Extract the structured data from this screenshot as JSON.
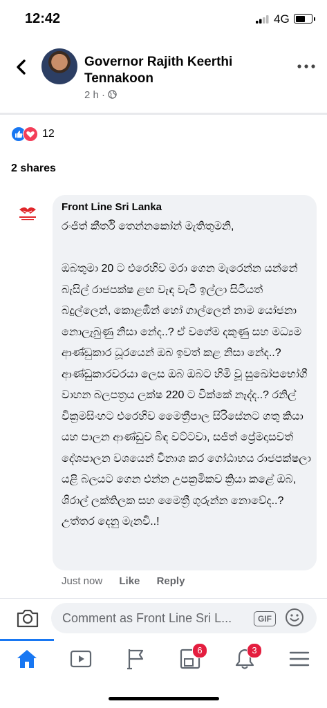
{
  "status_bar": {
    "time": "12:42",
    "network": "4G"
  },
  "post": {
    "author": "Governor Rajith Keerthi Tennakoon",
    "meta": "2 h ·",
    "reaction_count": "12",
    "shares": "2 shares"
  },
  "comment": {
    "author": "Front Line Sri Lanka",
    "text": "රංජිත් කීර්ති තෙන්නකෝන් මැතිතුමනි,\n\nඔබතුමා 20 ට එරෙහිව මරා ගෙන මැරෙන්න යන්නේ බැසිල් රාජපක්ෂ ළඟ වැඳ වැටී ඉල්ලා සිටියත් බදුල්ලෙන්, කොළඹින් හෝ ගාල්ලෙන් නාම යෝජනා නොලැබුණු නිසා නේද..? ඒ වගේම දකුණු සහ මධ්‍යම ආණ්ඩුකාර ධූරයෙන් ඔබ ඉවත් කළ නිසා නේද..? ආණ්ඩුකාරවරයා ලෙස ඔබ ඔබට හිමි වූ සුඛෝපභෝගී වාහන බලපත්‍රය ලක්ෂ 220 ට වික්කේ නැද්ද..? රනිල් වික්‍රමසිංහට එරෙහිව මෛත්‍රීපාල සිරිසේනට ගතු කියා යහ පාලන ආණ්ඩුව බිඳ වට්ටවා, සජිත් ප්‍රේමදාසවත් දේශපාලන වශයෙන් විනාශ කර ගෝඨාභය රාජපක්ෂලා යළි බලයට ගෙන එන්න උපක්‍රමිකව ක්‍රියා කළේ ඔබ, ශිරාල් ලක්තිලක සහ මෛත්‍රී ගුරුන්න නොවේද..? උත්තර දෙනු මැනවි..!",
    "time": "Just now",
    "like_label": "Like",
    "reply_label": "Reply"
  },
  "composer": {
    "placeholder": "Comment as Front Line Sri L...",
    "gif_label": "GIF"
  },
  "tabs": {
    "groups_badge": "6",
    "notifications_badge": "3"
  },
  "colors": {
    "accent": "#1877f2",
    "badge": "#e41e3f",
    "bubble": "#f0f2f5"
  },
  "icons": [
    "signal-icon",
    "battery-icon",
    "back-icon",
    "globe-icon",
    "more-icon",
    "like-reaction-icon",
    "love-reaction-icon",
    "camera-icon",
    "emoji-icon",
    "home-icon",
    "watch-icon",
    "pages-icon",
    "groups-icon",
    "notifications-icon",
    "menu-icon"
  ]
}
